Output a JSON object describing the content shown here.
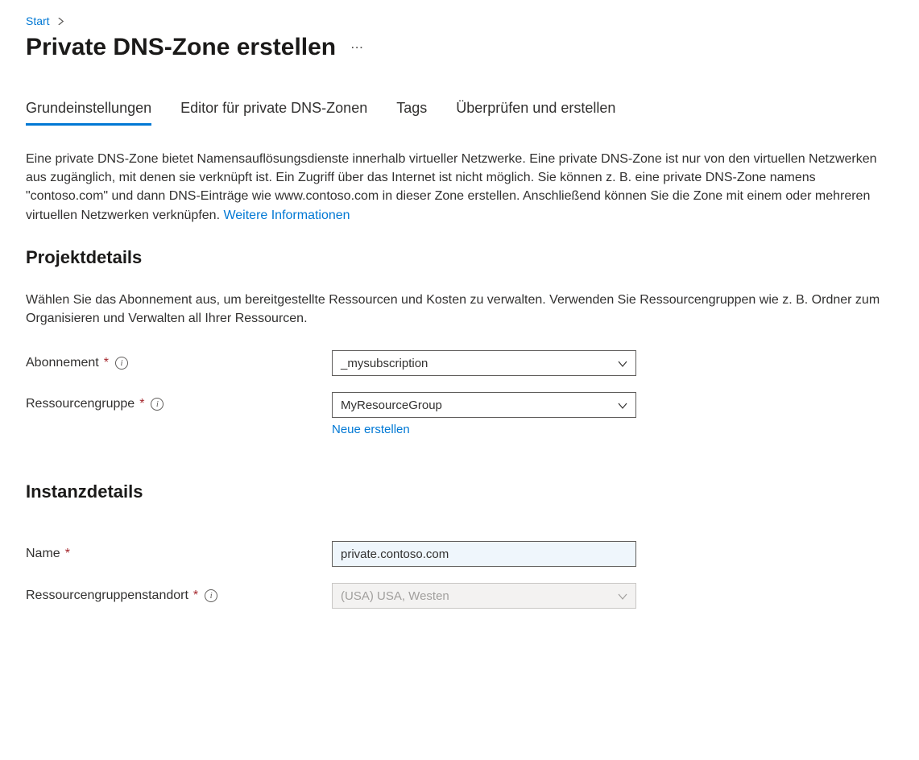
{
  "breadcrumb": {
    "start": "Start"
  },
  "header": {
    "title": "Private DNS-Zone erstellen"
  },
  "tabs": [
    {
      "label": "Grundeinstellungen",
      "active": true
    },
    {
      "label": "Editor für private DNS-Zonen",
      "active": false
    },
    {
      "label": "Tags",
      "active": false
    },
    {
      "label": "Überprüfen und erstellen",
      "active": false
    }
  ],
  "intro": {
    "text": "Eine private DNS-Zone bietet Namensauflösungsdienste innerhalb virtueller Netzwerke. Eine private DNS-Zone ist nur von den virtuellen Netzwerken aus zugänglich, mit denen sie verknüpft ist. Ein Zugriff über das Internet ist nicht möglich. Sie können z. B. eine private DNS-Zone namens \"contoso.com\" und dann DNS-Einträge wie www.contoso.com in dieser Zone erstellen. Anschließend können Sie die Zone mit einem oder mehreren virtuellen Netzwerken verknüpfen. ",
    "link": "Weitere Informationen"
  },
  "project": {
    "title": "Projektdetails",
    "desc": "Wählen Sie das Abonnement aus, um bereitgestellte Ressourcen und Kosten zu verwalten. Verwenden Sie Ressourcengruppen wie z. B. Ordner zum Organisieren und Verwalten all Ihrer Ressourcen.",
    "subscription_label": "Abonnement",
    "subscription_value": "_mysubscription",
    "resourcegroup_label": "Ressourcengruppe",
    "resourcegroup_value": "MyResourceGroup",
    "create_new": "Neue erstellen"
  },
  "instance": {
    "title": "Instanzdetails",
    "name_label": "Name",
    "name_value": "private.contoso.com",
    "location_label": "Ressourcengruppenstandort",
    "location_value": "(USA) USA, Westen"
  }
}
